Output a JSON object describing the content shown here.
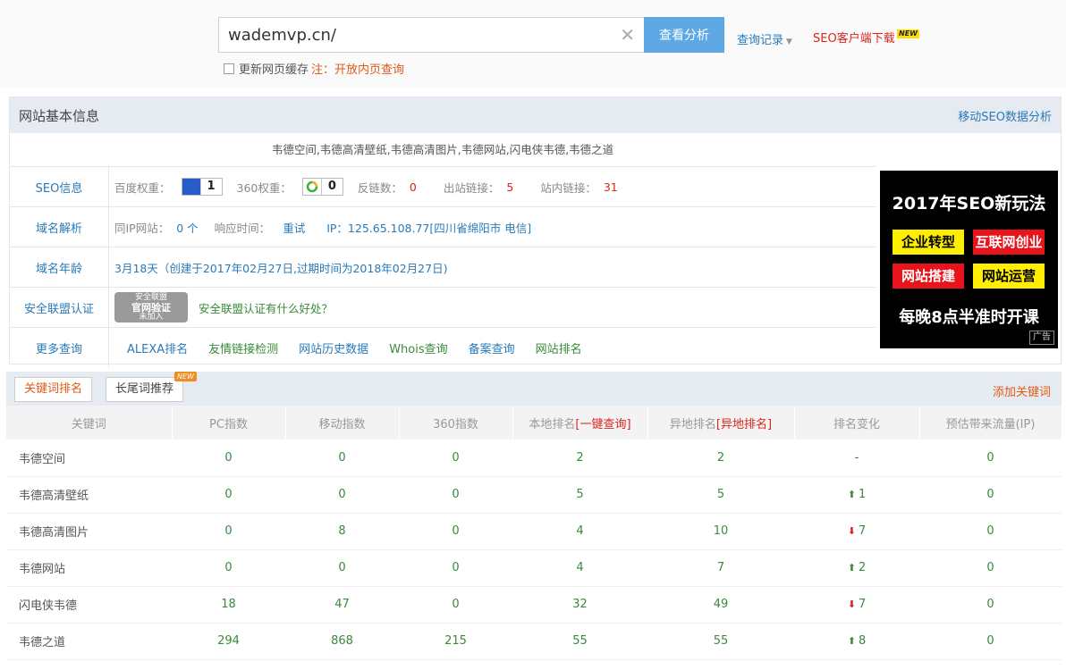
{
  "search": {
    "value": "wademvp.cn/",
    "button": "查看分析",
    "history": "查询记录",
    "client": "SEO客户端下载",
    "new_badge": "NEW",
    "cache_label": "更新网页缓存",
    "cache_note": "注：开放内页查询"
  },
  "panel": {
    "title": "网站基本信息",
    "mobile_link": "移动SEO数据分析",
    "description": "韦德空间,韦德高清壁纸,韦德高清图片,韦德网站,闪电侠韦德,韦德之道"
  },
  "seo": {
    "label": "SEO信息",
    "baidu_label": "百度权重：",
    "baidu_value": "1",
    "so360_label": "360权重：",
    "so360_value": "0",
    "backlinks_label": "反链数：",
    "backlinks_value": "0",
    "outlinks_label": "出站链接：",
    "outlinks_value": "5",
    "inlinks_label": "站内链接：",
    "inlinks_value": "31"
  },
  "dns": {
    "label": "域名解析",
    "same_ip_label": "同IP网站：",
    "same_ip_value": "0 个",
    "response_label": "响应时间：",
    "retry": "重试",
    "ip": "IP：125.65.108.77[四川省绵阳市 电信]"
  },
  "age": {
    "label": "域名年龄",
    "value": "3月18天（创建于2017年02月27日,过期时间为2018年02月27日)"
  },
  "security": {
    "label": "安全联盟认证",
    "seal_top": "安全联盟",
    "seal_main": "官网验证",
    "seal_sub": "未加入",
    "link": "安全联盟认证有什么好处？"
  },
  "more": {
    "label": "更多查询",
    "links": [
      "ALEXA排名",
      "友情链接检测",
      "网站历史数据",
      "Whois查询",
      "备案查询",
      "网站排名"
    ]
  },
  "ad": {
    "title": "2017年SEO新玩法",
    "tags": [
      "企业转型",
      "互联网创业",
      "网站搭建",
      "网站运营"
    ],
    "bottom": "每晚8点半准时开课",
    "mark": "广告"
  },
  "keywords": {
    "tab_active": "关键词排名",
    "tab_other": "长尾词推荐",
    "new_badge": "NEW",
    "add": "添加关键词",
    "headers": [
      "关键词",
      "PC指数",
      "移动指数",
      "360指数",
      "本地排名",
      "[一键查询]",
      "异地排名",
      "[异地排名]",
      "排名变化",
      "预估带来流量(IP)"
    ],
    "rows": [
      {
        "kw": "韦德空间",
        "pc": "0",
        "mobile": "0",
        "s360": "0",
        "local": "2",
        "remote": "2",
        "dir": "",
        "change": "-",
        "traffic": "0"
      },
      {
        "kw": "韦德高清壁纸",
        "pc": "0",
        "mobile": "0",
        "s360": "0",
        "local": "5",
        "remote": "5",
        "dir": "up",
        "change": "1",
        "traffic": "0"
      },
      {
        "kw": "韦德高清图片",
        "pc": "0",
        "mobile": "8",
        "s360": "0",
        "local": "4",
        "remote": "10",
        "dir": "down",
        "change": "7",
        "traffic": "0"
      },
      {
        "kw": "韦德网站",
        "pc": "0",
        "mobile": "0",
        "s360": "0",
        "local": "4",
        "remote": "7",
        "dir": "up",
        "change": "2",
        "traffic": "0"
      },
      {
        "kw": "闪电侠韦德",
        "pc": "18",
        "mobile": "47",
        "s360": "0",
        "local": "32",
        "remote": "49",
        "dir": "down",
        "change": "7",
        "traffic": "0"
      },
      {
        "kw": "韦德之道",
        "pc": "294",
        "mobile": "868",
        "s360": "215",
        "local": "55",
        "remote": "55",
        "dir": "up",
        "change": "8",
        "traffic": "0"
      }
    ]
  }
}
